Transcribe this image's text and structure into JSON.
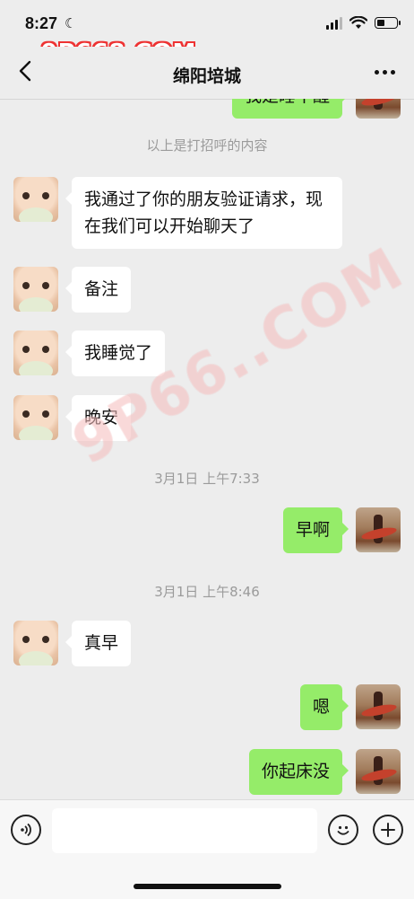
{
  "status_bar": {
    "time": "8:27",
    "moon_icon": "moon-icon",
    "signal_icon": "cellular-signal-icon",
    "wifi_icon": "wifi-icon",
    "battery_icon": "battery-icon",
    "battery_level": 0.4
  },
  "watermark": {
    "top": "9P668.COM",
    "center": "9P66..COM"
  },
  "nav": {
    "back_icon": "chevron-left-icon",
    "title": "绵阳培城",
    "more_icon": "more-dots-icon"
  },
  "messages": {
    "partial_out": "我是睡不醒",
    "sys_greeting": "以上是打招呼的内容",
    "m1": "我通过了你的朋友验证请求，现在我们可以开始聊天了",
    "m2": "备注",
    "m3": "我睡觉了",
    "m4": "晚安",
    "time1": "3月1日 上午7:33",
    "m5": "早啊",
    "time2": "3月1日 上午8:46",
    "m6": "真早",
    "m7": "嗯",
    "m8": "你起床没"
  },
  "input_bar": {
    "voice_icon": "voice-icon",
    "emoji_icon": "emoji-icon",
    "plus_icon": "plus-icon",
    "placeholder": ""
  },
  "colors": {
    "background": "#ededed",
    "incoming_bubble": "#ffffff",
    "outgoing_bubble": "#95ec69",
    "system_text": "#9b9b9b"
  }
}
